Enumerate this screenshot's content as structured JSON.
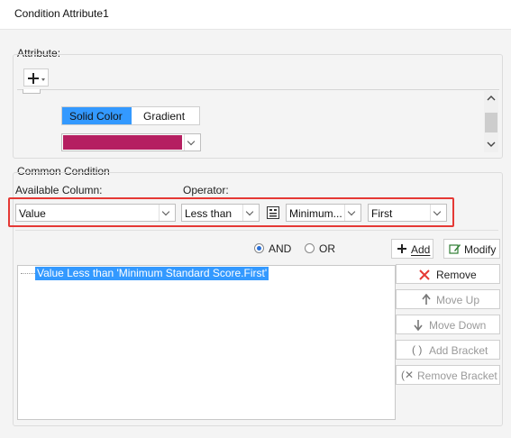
{
  "window": {
    "title": "Condition Attribute1"
  },
  "attribute": {
    "group_label": "Attribute:",
    "tabs": [
      {
        "label": "Solid Color",
        "selected": true
      },
      {
        "label": "Gradient",
        "selected": false
      }
    ],
    "color_swatch": "#b51f61"
  },
  "condition": {
    "group_label": "Common Condition",
    "available_column_label": "Available Column:",
    "operator_label": "Operator:",
    "column_value": "Value",
    "operator_value": "Less than",
    "formula_value": "Minimum...",
    "position_value": "First",
    "logic": {
      "and_label": "AND",
      "or_label": "OR",
      "selected": "AND"
    },
    "add_label": "Add",
    "modify_label": "Modify",
    "list": [
      "Value Less than 'Minimum Standard Score.First'"
    ],
    "buttons": {
      "remove": "Remove",
      "move_up": "Move Up",
      "move_down": "Move Down",
      "add_bracket": "Add Bracket",
      "remove_bracket": "Remove Bracket"
    }
  },
  "colors": {
    "accent": "#3399ff",
    "highlight_outline": "#e53935",
    "selection": "#3399ff"
  }
}
